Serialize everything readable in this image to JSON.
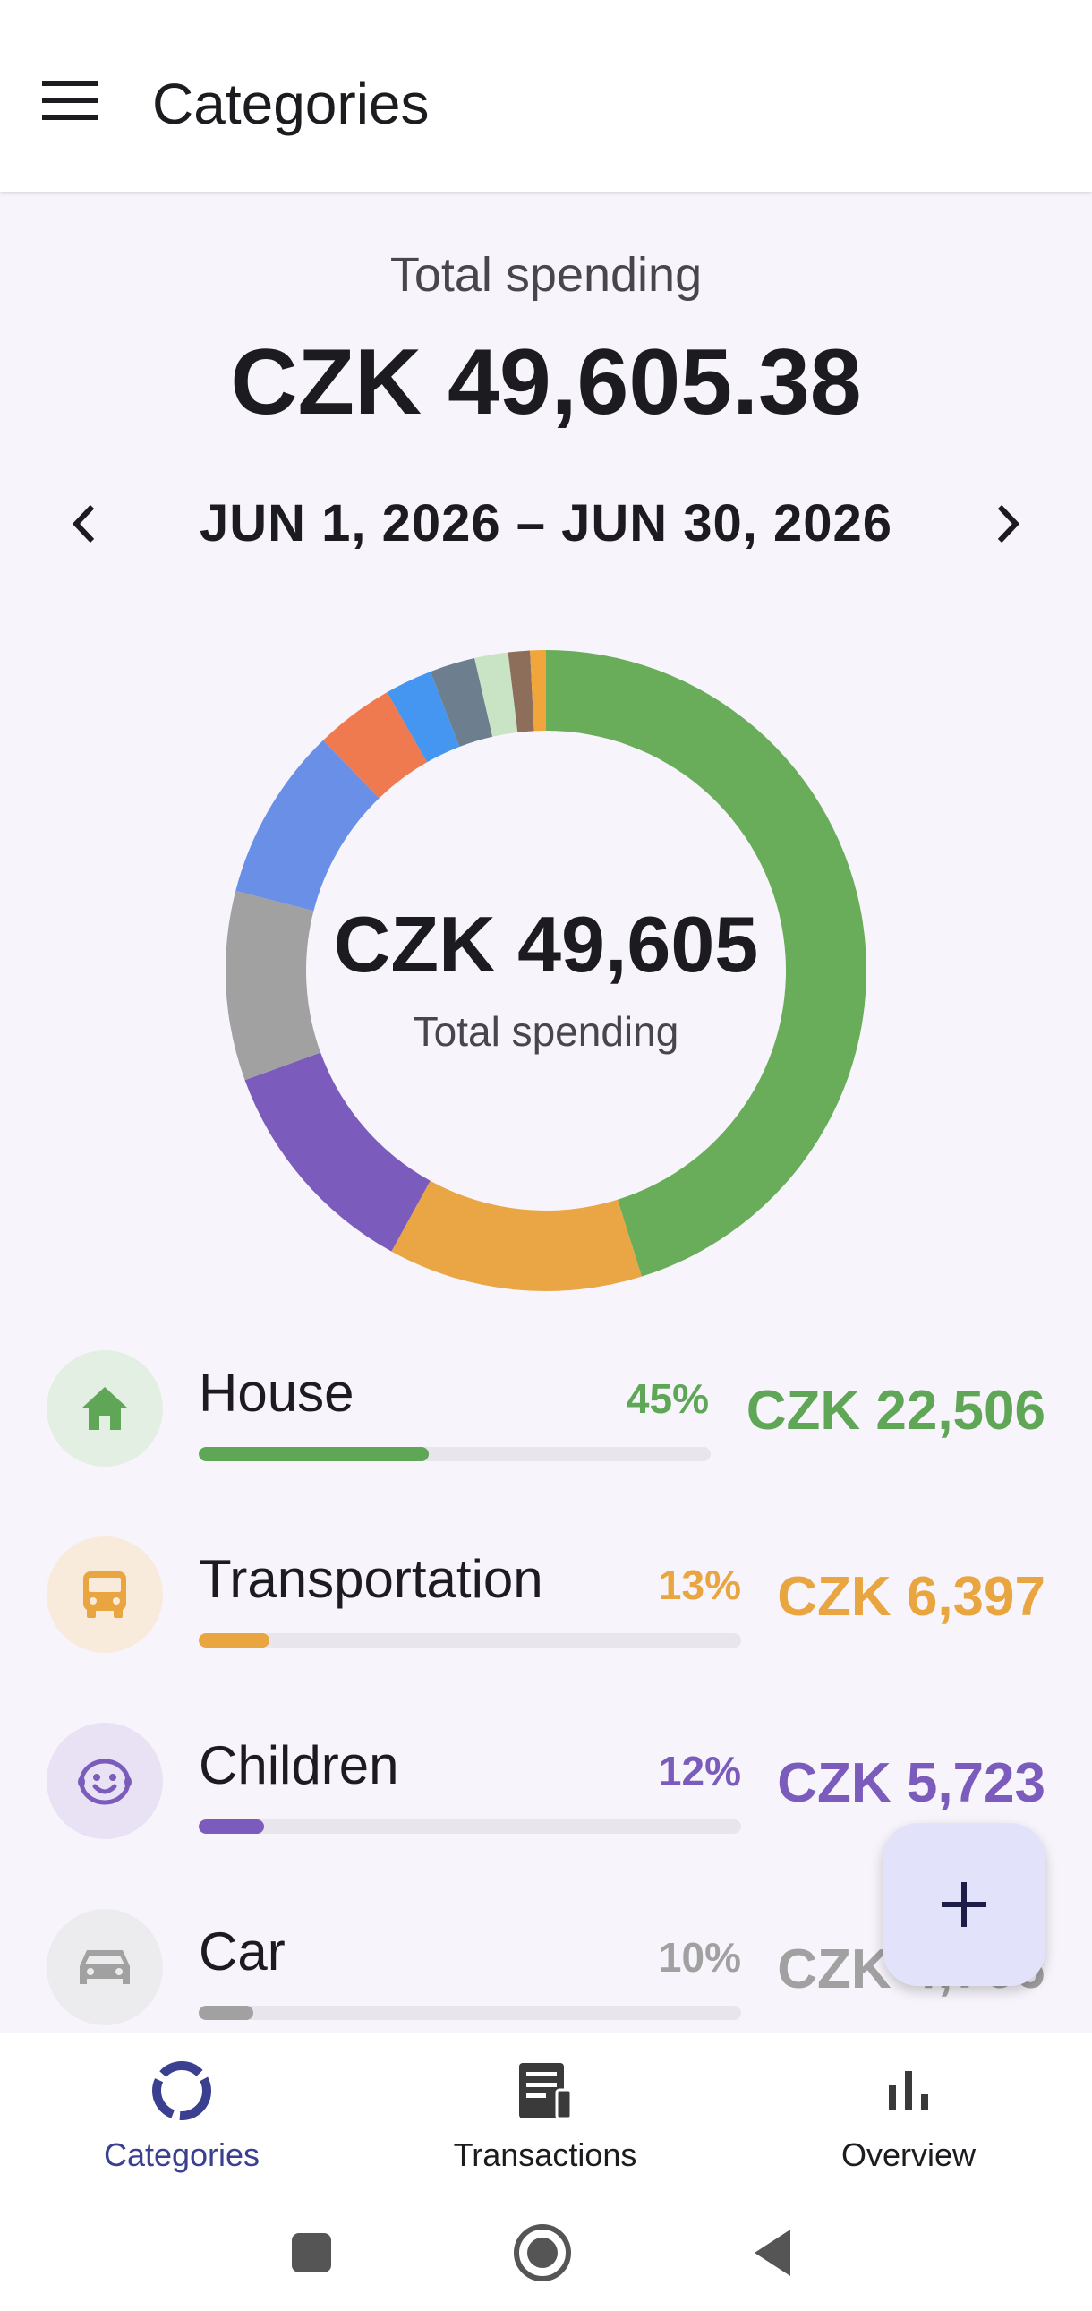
{
  "app_bar": {
    "title": "Categories",
    "menu_icon": "hamburger-menu-icon"
  },
  "summary": {
    "label": "Total spending",
    "amount": "CZK 49,605.38",
    "period": "JUN 1, 2026 – JUN 30, 2026"
  },
  "donut": {
    "center_amount": "CZK 49,605",
    "center_label": "Total spending",
    "slices": [
      {
        "value": 45.4,
        "color": "#69ad5b"
      },
      {
        "value": 12.9,
        "color": "#eaa644"
      },
      {
        "value": 11.5,
        "color": "#7b5cbc"
      },
      {
        "value": 9.6,
        "color": "#a1a1a1"
      },
      {
        "value": 8.8,
        "color": "#6a8fe6"
      },
      {
        "value": 4.0,
        "color": "#ef7a50"
      },
      {
        "value": 2.4,
        "color": "#4496f0"
      },
      {
        "value": 2.3,
        "color": "#6d7f8e"
      },
      {
        "value": 1.7,
        "color": "#c9e4c5"
      },
      {
        "value": 1.1,
        "color": "#8d6e5b"
      },
      {
        "value": 0.8,
        "color": "#f0a63a"
      }
    ]
  },
  "categories": [
    {
      "name": "House",
      "percent": "45%",
      "amount": "CZK 22,506",
      "progress": 0.45,
      "color": "#5fa657",
      "bg": "#e3efe2",
      "icon": "house-icon"
    },
    {
      "name": "Transportation",
      "percent": "13%",
      "amount": "CZK 6,397",
      "progress": 0.13,
      "color": "#e9a540",
      "bg": "#f8ebdc",
      "icon": "bus-icon"
    },
    {
      "name": "Children",
      "percent": "12%",
      "amount": "CZK 5,723",
      "progress": 0.12,
      "color": "#7b5cbc",
      "bg": "#e8e2f4",
      "icon": "child-face-icon"
    },
    {
      "name": "Car",
      "percent": "10%",
      "amount": "CZK 4,766",
      "progress": 0.1,
      "color": "#a1a1a1",
      "bg": "#ececee",
      "icon": "car-icon"
    }
  ],
  "fab": {
    "icon": "plus-icon"
  },
  "bottom_nav": [
    {
      "label": "Categories",
      "icon": "donut-chart-icon",
      "active": true
    },
    {
      "label": "Transactions",
      "icon": "receipt-icon",
      "active": false
    },
    {
      "label": "Overview",
      "icon": "bar-chart-icon",
      "active": false
    }
  ],
  "system_nav": [
    "recents-icon",
    "home-icon",
    "back-icon"
  ]
}
